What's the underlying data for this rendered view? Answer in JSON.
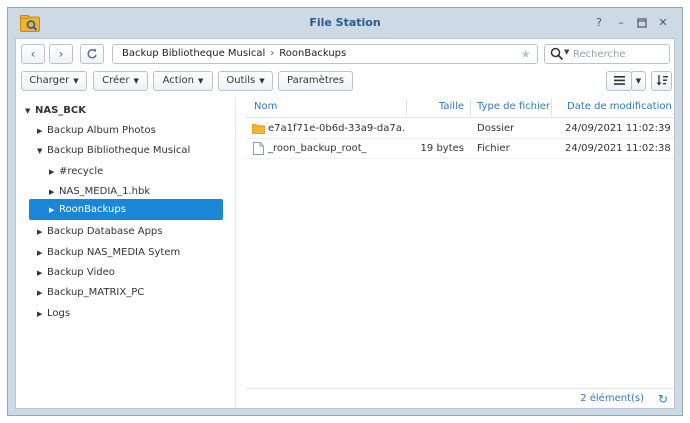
{
  "window": {
    "title": "File Station"
  },
  "nav": {
    "path": [
      "Backup Bibliotheque Musical",
      "RoonBackups"
    ],
    "search_placeholder": "Recherche"
  },
  "toolbar": {
    "upload": "Charger",
    "create": "Créer",
    "action": "Action",
    "tools": "Outils",
    "settings": "Paramètres"
  },
  "sidebar": {
    "root": "NAS_BCK",
    "items": [
      {
        "label": "Backup Album Photos"
      },
      {
        "label": "Backup Bibliotheque Musical"
      },
      {
        "label": "#recycle"
      },
      {
        "label": "NAS_MEDIA_1.hbk"
      },
      {
        "label": "RoonBackups"
      },
      {
        "label": "Backup Database Apps"
      },
      {
        "label": "Backup NAS_MEDIA Sytem"
      },
      {
        "label": "Backup Video"
      },
      {
        "label": "Backup_MATRIX_PC"
      },
      {
        "label": "Logs"
      }
    ],
    "selected": "RoonBackups"
  },
  "files": {
    "columns": [
      "Nom",
      "Taille",
      "Type de fichier",
      "Date de modification"
    ],
    "rows": [
      {
        "name": "e7a1f71e-0b6d-33a9-da7a...",
        "size": "",
        "type": "Dossier",
        "modified": "24/09/2021 11:02:39",
        "icon": "folder-icon"
      },
      {
        "name": "_roon_backup_root_",
        "size": "19 bytes",
        "type": "Fichier",
        "modified": "24/09/2021 11:02:38",
        "icon": "file-icon"
      }
    ],
    "count": "2 élément(s)"
  },
  "colors": {
    "accent": "#1a86d8",
    "header_text": "#2f7ac0",
    "title": "#2c5c8c",
    "folder": "#f3b431"
  }
}
